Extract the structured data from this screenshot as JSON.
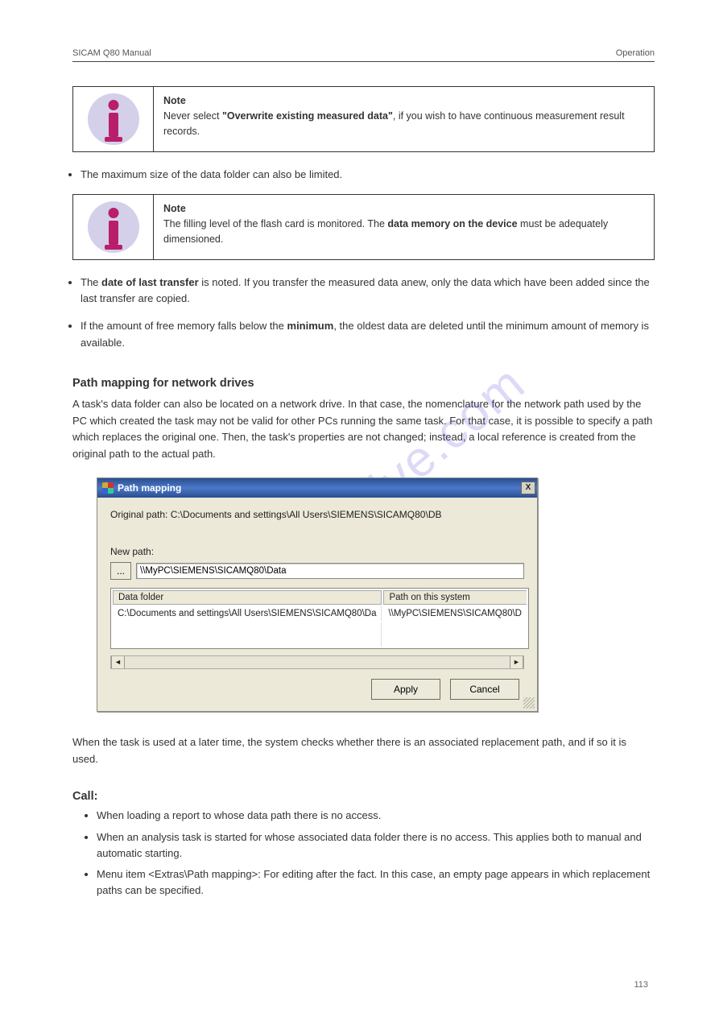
{
  "header": {
    "left": "SICAM Q80 Manual",
    "right": "Operation",
    "page_number": "113"
  },
  "watermark": "manualshive.com",
  "infobox1": {
    "note_label": "Note",
    "text_1": "Never select ",
    "bold_1": "\"Overwrite existing measured data\"",
    "text_2": ", if you wish to have continuous measurement result records."
  },
  "bullets_top": [
    "The maximum size of the data folder can also be limited."
  ],
  "infobox2": {
    "note_label": "Note",
    "text_1": "The filling level of the flash card is monitored. The ",
    "bold_1": "data memory on the device",
    "text_2": " must be adequately dimensioned."
  },
  "bullets_mid": [
    {
      "pre": "The ",
      "bold": "date of last transfer",
      "post": " is noted. If you transfer the measured data anew, only the data which have been added since the last transfer are copied."
    },
    {
      "pre": "If the amount of free memory falls below the ",
      "bold": "minimum",
      "post": ", the oldest data are deleted until the minimum amount of memory is available."
    }
  ],
  "path_mapping_heading": "Path mapping for network drives",
  "path_mapping_para": "A task's data folder can also be located on a network drive. In that case, the nomenclature for the network path used by the PC which created the task may not be valid for other PCs running the same task. For that case, it is possible to specify a path which replaces the original one. Then, the task's properties are not changed; instead, a local reference is created from the original path to the actual path.",
  "dialog": {
    "title": "Path mapping",
    "original_path_label": "Original path: C:\\Documents and settings\\All Users\\SIEMENS\\SICAMQ80\\DB",
    "new_path_label": "New path:",
    "browse_btn": "...",
    "new_path_value": "\\\\MyPC\\SIEMENS\\SICAMQ80\\Data",
    "col1": "Data folder",
    "col2": "Path on this system",
    "row1_c1": "C:\\Documents and settings\\All Users\\SIEMENS\\SICAMQ80\\Da",
    "row1_c2": "\\\\MyPC\\SIEMENS\\SICAMQ80\\D",
    "apply": "Apply",
    "cancel": "Cancel",
    "close_x": "X"
  },
  "path_mapping_para2": "When the task is used at a later time, the system checks whether there is an associated replacement path, and if so it is used.",
  "call_heading": "Call:",
  "call_bullets": [
    "When loading a report to whose data path there is no access.",
    "When an analysis task is started for whose associated data folder there is no access. This applies both to manual and automatic starting.",
    "Menu item <Extras\\Path mapping>: For editing after the fact. In this case, an empty page appears in which replacement paths can be specified."
  ]
}
